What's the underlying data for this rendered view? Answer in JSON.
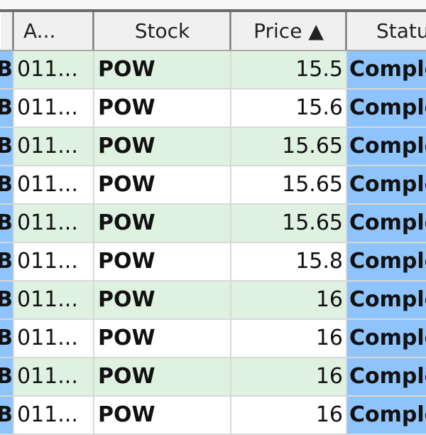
{
  "columns": [
    {
      "label": ""
    },
    {
      "label": "A..."
    },
    {
      "label": "Stock"
    },
    {
      "label": "Price ▲"
    },
    {
      "label": "Statu"
    }
  ],
  "rows": [
    {
      "c0": "B",
      "account": "011...",
      "stock": "POW",
      "price": "15.5",
      "status": "Comple"
    },
    {
      "c0": "B",
      "account": "011...",
      "stock": "POW",
      "price": "15.6",
      "status": "Comple"
    },
    {
      "c0": "B",
      "account": "011...",
      "stock": "POW",
      "price": "15.65",
      "status": "Comple"
    },
    {
      "c0": "B",
      "account": "011...",
      "stock": "POW",
      "price": "15.65",
      "status": "Comple"
    },
    {
      "c0": "B",
      "account": "011...",
      "stock": "POW",
      "price": "15.65",
      "status": "Comple"
    },
    {
      "c0": "B",
      "account": "011...",
      "stock": "POW",
      "price": "15.8",
      "status": "Comple"
    },
    {
      "c0": "B",
      "account": "011...",
      "stock": "POW",
      "price": "16",
      "status": "Comple"
    },
    {
      "c0": "B",
      "account": "011...",
      "stock": "POW",
      "price": "16",
      "status": "Comple"
    },
    {
      "c0": "B",
      "account": "011...",
      "stock": "POW",
      "price": "16",
      "status": "Comple"
    },
    {
      "c0": "B",
      "account": "011...",
      "stock": "POW",
      "price": "16",
      "status": "Comple"
    }
  ]
}
